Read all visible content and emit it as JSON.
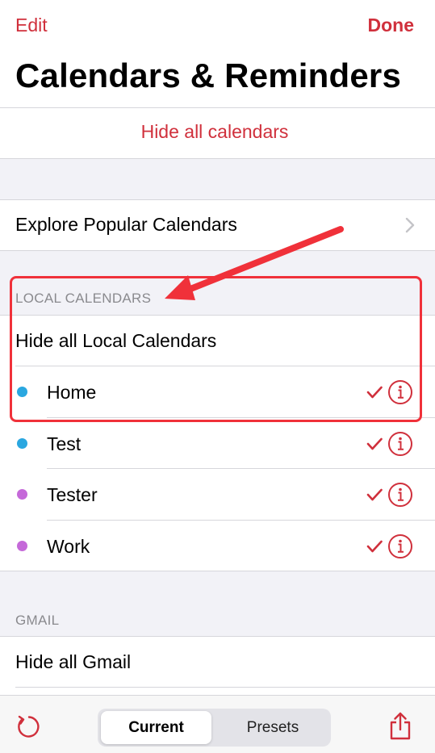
{
  "header": {
    "edit_label": "Edit",
    "done_label": "Done",
    "title": "Calendars & Reminders"
  },
  "hide_all_calendars": "Hide all calendars",
  "explore_label": "Explore Popular Calendars",
  "local_section": {
    "title": "LOCAL CALENDARS",
    "hide_all": "Hide all Local Calendars",
    "calendars": [
      {
        "name": "Home",
        "color": "#2aa7e0",
        "checked": true
      },
      {
        "name": "Test",
        "color": "#2aa7e0",
        "checked": true
      },
      {
        "name": "Tester",
        "color": "#c569d9",
        "checked": true
      },
      {
        "name": "Work",
        "color": "#c569d9",
        "checked": true
      }
    ]
  },
  "gmail_section": {
    "title": "GMAIL",
    "hide_all": "Hide all Gmail"
  },
  "toolbar": {
    "current_label": "Current",
    "presets_label": "Presets",
    "selected_segment": "Current"
  },
  "colors": {
    "accent": "#d0303c",
    "annotation": "#f0313a"
  }
}
